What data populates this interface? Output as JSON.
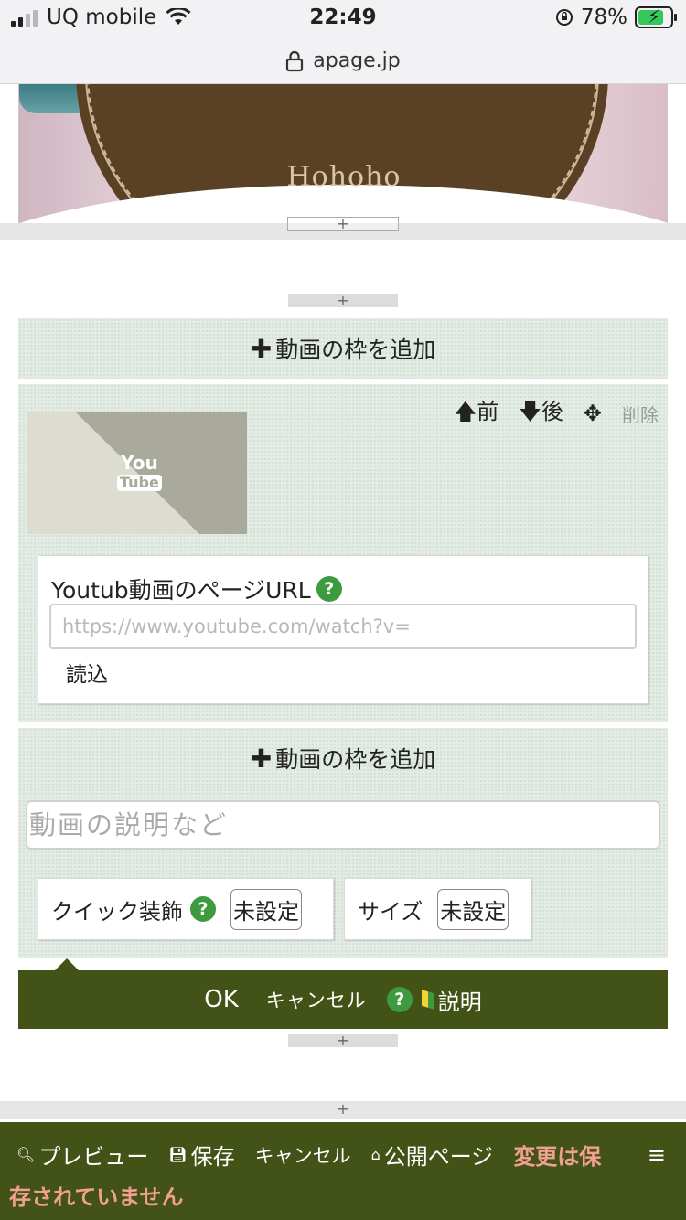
{
  "status": {
    "carrier": "UQ mobile",
    "time": "22:49",
    "battery": "78%",
    "battery_level": 0.78,
    "url": "apage.jp"
  },
  "hero": {
    "text": "Hohoho"
  },
  "editor": {
    "add_video_frame": "動画の枠を追加",
    "move_up": "前",
    "move_down": "後",
    "delete": "削除",
    "thumbnail_logo_top": "You",
    "thumbnail_logo_bottom": "Tube",
    "url_label": "Youtub動画のページURL",
    "url_placeholder": "https://www.youtube.com/watch?v=",
    "load": "読込",
    "description_placeholder": "動画の説明など",
    "quick_decoration_label": "クイック装飾",
    "quick_decoration_value": "未設定",
    "size_label": "サイズ",
    "size_value": "未設定"
  },
  "action_bar": {
    "ok": "OK",
    "cancel": "キャンセル",
    "help": "説明"
  },
  "bottom_bar": {
    "preview": "プレビュー",
    "save": "保存",
    "cancel": "キャンセル",
    "public_page": "公開ページ",
    "warning_part1": "変更は保",
    "warning_part2": "存されていません"
  },
  "colors": {
    "dark_green": "#435216",
    "help_green": "#3d9a3f",
    "warning_salmon": "#f0a090",
    "panel_bg": "#e3ece4"
  }
}
